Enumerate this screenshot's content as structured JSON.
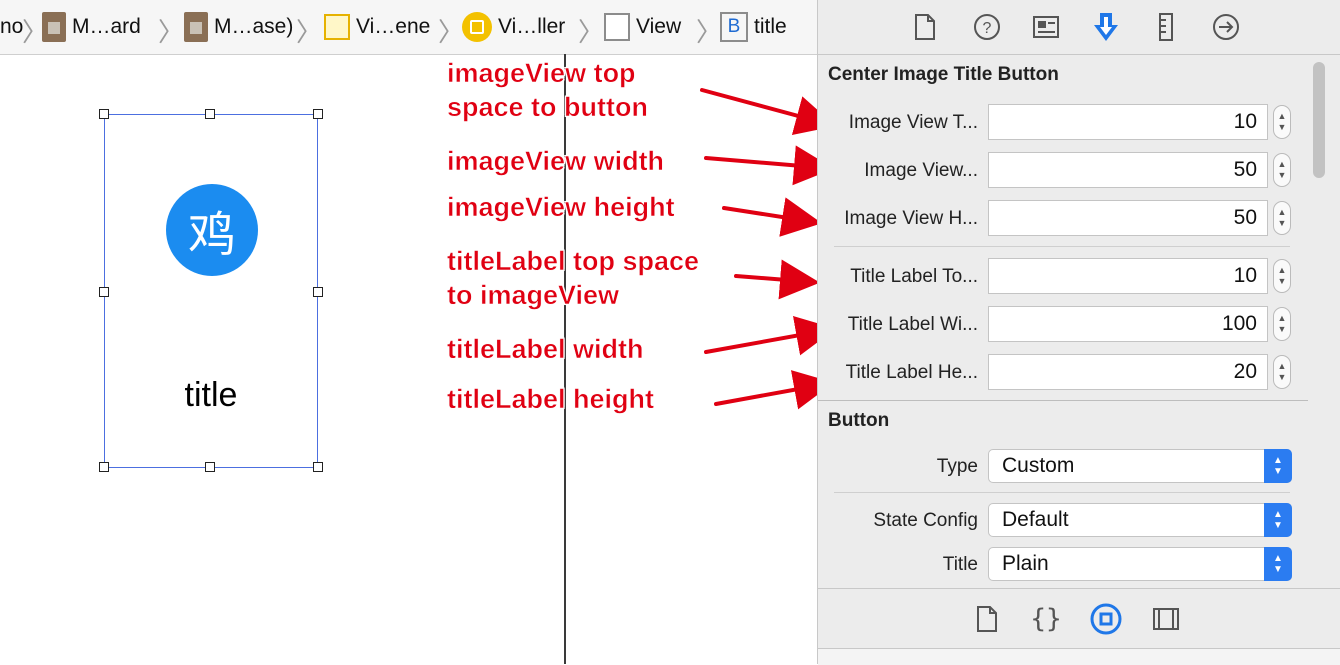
{
  "breadcrumb": [
    {
      "label": "no",
      "icon": "none"
    },
    {
      "label": "M…ard",
      "icon": "storyboard-file-icon"
    },
    {
      "label": "M…ase)",
      "icon": "storyboard-file-icon"
    },
    {
      "label": "Vi…ene",
      "icon": "scene-icon"
    },
    {
      "label": "Vi…ller",
      "icon": "view-controller-icon"
    },
    {
      "label": "View",
      "icon": "view-icon"
    },
    {
      "label": "title",
      "icon": "button-icon",
      "icon_text": "B"
    }
  ],
  "canvas": {
    "button_icon_glyph": "鸡",
    "button_title": "title",
    "selection_color": "#4c6fe0",
    "icon_bg_color": "#1b8cf0"
  },
  "annotations": [
    {
      "lines": [
        "imageView top",
        "space to button"
      ]
    },
    {
      "lines": [
        "imageView width"
      ]
    },
    {
      "lines": [
        "imageView height"
      ]
    },
    {
      "lines": [
        "titleLabel top space",
        "to imageView"
      ]
    },
    {
      "lines": [
        "titleLabel width"
      ]
    },
    {
      "lines": [
        "titleLabel height"
      ]
    }
  ],
  "inspector": {
    "tabs": [
      "file-inspector-icon",
      "help-icon",
      "identity-inspector-icon",
      "attributes-inspector-icon",
      "size-inspector-icon",
      "connections-inspector-icon"
    ],
    "active_tab": "attributes-inspector-icon",
    "custom_section": {
      "title": "Center Image Title Button",
      "fields": [
        {
          "label": "Image View T...",
          "value": "10"
        },
        {
          "label": "Image View...",
          "value": "50"
        },
        {
          "label": "Image View H...",
          "value": "50"
        },
        {
          "label": "Title Label To...",
          "value": "10"
        },
        {
          "label": "Title Label Wi...",
          "value": "100"
        },
        {
          "label": "Title Label He...",
          "value": "20"
        }
      ]
    },
    "button_section": {
      "title": "Button",
      "type_label": "Type",
      "type_value": "Custom",
      "state_label": "State Config",
      "state_value": "Default",
      "title_label": "Title",
      "title_value": "Plain"
    },
    "library_tabs": [
      "file-template-icon",
      "code-snippet-icon",
      "object-library-icon",
      "media-library-icon"
    ],
    "active_library_tab": "object-library-icon",
    "accent_color": "#2b7cf1"
  }
}
